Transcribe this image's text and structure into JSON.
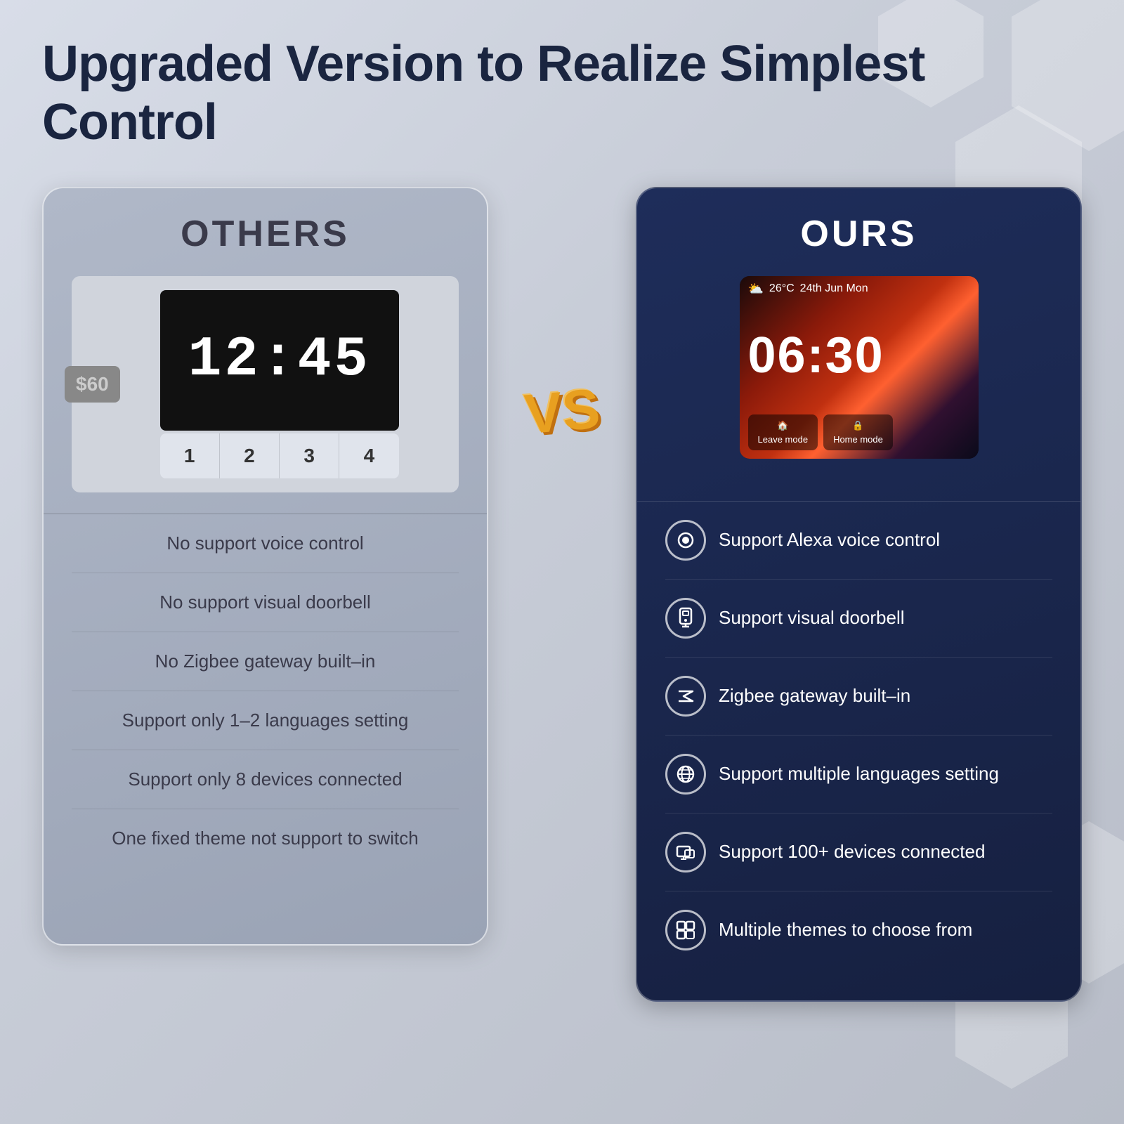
{
  "page": {
    "title": "Upgraded Version to Realize Simplest Control",
    "bg_colors": [
      "#d8dde8",
      "#c8cdd8"
    ]
  },
  "others": {
    "card_title": "OTHERS",
    "price": "$60",
    "clock_time": "12:45",
    "buttons": [
      "1",
      "2",
      "3",
      "4"
    ],
    "features": [
      "No support voice control",
      "No support visual doorbell",
      "No Zigbee gateway built–in",
      "Support only 1–2 languages setting",
      "Support only 8 devices connected",
      "One fixed theme not support to switch"
    ]
  },
  "vs_label": "VS",
  "ours": {
    "card_title": "OURS",
    "weather": "26°C",
    "date": "24th Jun Mon",
    "clock_time": "06:30",
    "mode1": "Leave mode",
    "mode2": "Home mode",
    "features": [
      {
        "icon": "🔘",
        "text": "Support Alexa voice control"
      },
      {
        "icon": "📱",
        "text": "Support visual doorbell"
      },
      {
        "icon": "⚡",
        "text": "Zigbee gateway built–in"
      },
      {
        "icon": "🌐",
        "text": "Support multiple languages setting"
      },
      {
        "icon": "🔗",
        "text": "Support 100+ devices connected"
      },
      {
        "icon": "🎨",
        "text": "Multiple themes to choose from"
      }
    ]
  }
}
